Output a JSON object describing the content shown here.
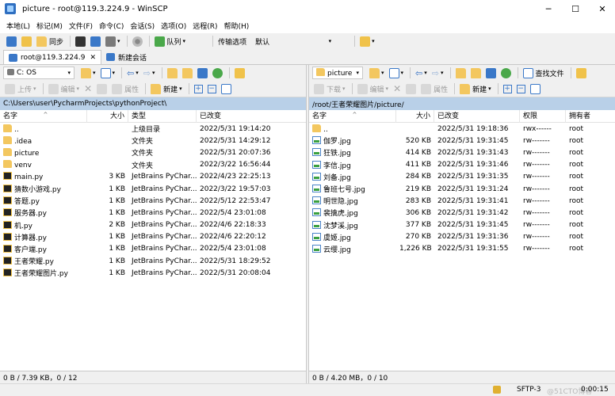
{
  "window": {
    "title": "picture - root@119.3.224.9 - WinSCP",
    "controls": [
      "minimize-icon",
      "maximize-icon",
      "close-icon"
    ]
  },
  "menubar": [
    "本地(L)",
    "标记(M)",
    "文件(F)",
    "命令(C)",
    "会话(S)",
    "选项(O)",
    "远程(R)",
    "帮助(H)"
  ],
  "toolbar": {
    "sync_label": "同步",
    "queue_label": "队列",
    "transfer_options_label": "传输选项",
    "transfer_options_value": "默认"
  },
  "session_tabs": {
    "active": "root@119.3.224.9",
    "new_session": "新建会话"
  },
  "left_panel": {
    "drive": "C: OS",
    "actions": {
      "upload": "上传",
      "edit": "编辑",
      "properties": "属性",
      "new": "新建"
    },
    "path": "C:\\Users\\user\\PycharmProjects\\pythonProject\\",
    "columns": [
      "名字",
      "大小",
      "类型",
      "已改变"
    ],
    "rows": [
      {
        "name": "..",
        "icon": "parent",
        "size": "",
        "type": "上级目录",
        "changed": "2022/5/31 19:14:20"
      },
      {
        "name": ".idea",
        "icon": "folder",
        "size": "",
        "type": "文件夹",
        "changed": "2022/5/31 14:29:12"
      },
      {
        "name": "picture",
        "icon": "folder",
        "size": "",
        "type": "文件夹",
        "changed": "2022/5/31 20:07:36"
      },
      {
        "name": "venv",
        "icon": "folder",
        "size": "",
        "type": "文件夹",
        "changed": "2022/3/22 16:56:44"
      },
      {
        "name": "main.py",
        "icon": "py",
        "size": "3 KB",
        "type": "JetBrains PyChar...",
        "changed": "2022/4/23 22:25:13"
      },
      {
        "name": "猜数小游戏.py",
        "icon": "py",
        "size": "1 KB",
        "type": "JetBrains PyChar...",
        "changed": "2022/3/22 19:57:03"
      },
      {
        "name": "答题.py",
        "icon": "py",
        "size": "1 KB",
        "type": "JetBrains PyChar...",
        "changed": "2022/5/12 22:53:47"
      },
      {
        "name": "服务器.py",
        "icon": "py",
        "size": "1 KB",
        "type": "JetBrains PyChar...",
        "changed": "2022/5/4 23:01:08"
      },
      {
        "name": "机.py",
        "icon": "py",
        "size": "2 KB",
        "type": "JetBrains PyChar...",
        "changed": "2022/4/6 22:18:33"
      },
      {
        "name": "计算器.py",
        "icon": "py",
        "size": "1 KB",
        "type": "JetBrains PyChar...",
        "changed": "2022/4/6 22:20:12"
      },
      {
        "name": "客户端.py",
        "icon": "py",
        "size": "1 KB",
        "type": "JetBrains PyChar...",
        "changed": "2022/5/4 23:01:08"
      },
      {
        "name": "王者荣耀.py",
        "icon": "py",
        "size": "1 KB",
        "type": "JetBrains PyChar...",
        "changed": "2022/5/31 18:29:52"
      },
      {
        "name": "王者荣耀图片.py",
        "icon": "py",
        "size": "1 KB",
        "type": "JetBrains PyChar...",
        "changed": "2022/5/31 20:08:04"
      }
    ],
    "status": "0 B / 7.39 KB，0 / 12"
  },
  "right_panel": {
    "folder": "picture",
    "find_files_label": "查找文件",
    "actions": {
      "download": "下载",
      "edit": "编辑",
      "properties": "属性",
      "new": "新建"
    },
    "path": "/root/王者荣耀图片/picture/",
    "columns": [
      "名字",
      "大小",
      "已改变",
      "权限",
      "拥有者"
    ],
    "rows": [
      {
        "name": "..",
        "icon": "parent",
        "size": "",
        "changed": "2022/5/31 19:18:36",
        "perm": "rwx------",
        "owner": "root"
      },
      {
        "name": "伽罗.jpg",
        "icon": "jpg",
        "size": "520 KB",
        "changed": "2022/5/31 19:31:45",
        "perm": "rw-------",
        "owner": "root"
      },
      {
        "name": "狂铁.jpg",
        "icon": "jpg",
        "size": "414 KB",
        "changed": "2022/5/31 19:31:43",
        "perm": "rw-------",
        "owner": "root"
      },
      {
        "name": "李信.jpg",
        "icon": "jpg",
        "size": "411 KB",
        "changed": "2022/5/31 19:31:46",
        "perm": "rw-------",
        "owner": "root"
      },
      {
        "name": "刘备.jpg",
        "icon": "jpg",
        "size": "284 KB",
        "changed": "2022/5/31 19:31:35",
        "perm": "rw-------",
        "owner": "root"
      },
      {
        "name": "鲁班七号.jpg",
        "icon": "jpg",
        "size": "219 KB",
        "changed": "2022/5/31 19:31:24",
        "perm": "rw-------",
        "owner": "root"
      },
      {
        "name": "明世隐.jpg",
        "icon": "jpg",
        "size": "283 KB",
        "changed": "2022/5/31 19:31:41",
        "perm": "rw-------",
        "owner": "root"
      },
      {
        "name": "裴擒虎.jpg",
        "icon": "jpg",
        "size": "306 KB",
        "changed": "2022/5/31 19:31:42",
        "perm": "rw-------",
        "owner": "root"
      },
      {
        "name": "沈梦溪.jpg",
        "icon": "jpg",
        "size": "377 KB",
        "changed": "2022/5/31 19:31:45",
        "perm": "rw-------",
        "owner": "root"
      },
      {
        "name": "虞姬.jpg",
        "icon": "jpg",
        "size": "270 KB",
        "changed": "2022/5/31 19:31:36",
        "perm": "rw-------",
        "owner": "root"
      },
      {
        "name": "云缨.jpg",
        "icon": "jpg",
        "size": "1,226 KB",
        "changed": "2022/5/31 19:31:55",
        "perm": "rw-------",
        "owner": "root"
      }
    ],
    "status": "0 B / 4.20 MB，0 / 10"
  },
  "bottom": {
    "protocol": "SFTP-3",
    "elapsed": "0:00:15",
    "watermark": "@51CTO博客"
  }
}
